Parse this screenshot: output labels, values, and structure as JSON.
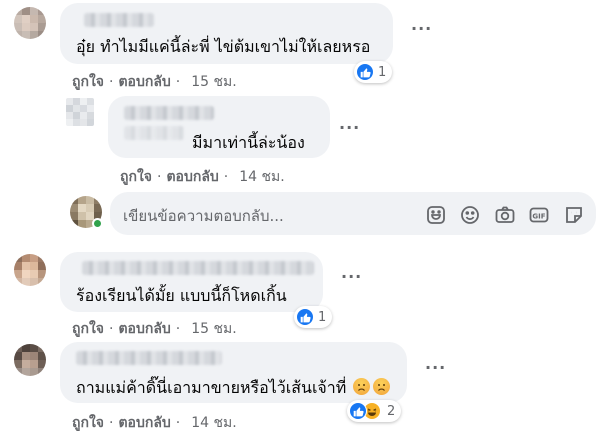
{
  "comments": [
    {
      "text": "อุ๋ย ทำไมมีแค่นี้ล่ะพี่ ไข่ต้มเขาไม่ให้เลยหรอ",
      "like_label": "ถูกใจ",
      "reply_label": "ตอบกลับ",
      "time": "15 ชม.",
      "reaction_count": "1"
    },
    {
      "text": "มีมาเท่านี้ล่ะน้อง",
      "like_label": "ถูกใจ",
      "reply_label": "ตอบกลับ",
      "time": "14 ชม."
    },
    {
      "text": "ร้องเรียนได้มั้ย แบบนี้ก็โหดเกิ้น",
      "like_label": "ถูกใจ",
      "reply_label": "ตอบกลับ",
      "time": "15 ชม.",
      "reaction_count": "1"
    },
    {
      "text": "ถามแม่ค้าดิ๊นี่เอามาขายหรือไว้เส้นเจ้าที่",
      "like_label": "ถูกใจ",
      "reply_label": "ตอบกลับ",
      "time": "14 ชม.",
      "reaction_count": "2"
    }
  ],
  "reply_input": {
    "placeholder": "เขียนข้อความตอบกลับ...",
    "tools": [
      "sticker-face-icon",
      "emoji-icon",
      "camera-icon",
      "gif-icon",
      "sticker-icon"
    ]
  },
  "colors": {
    "bubble": "#f0f2f5",
    "secondary_text": "#65676b",
    "like_blue": "#1877f2",
    "online_green": "#31a24c"
  }
}
